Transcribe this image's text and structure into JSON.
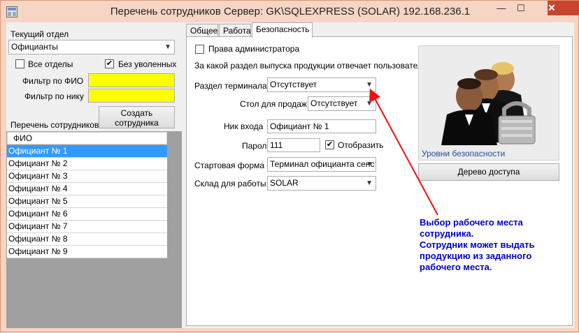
{
  "window": {
    "title": "Перечень сотрудников  Сервер: GK\\SQLEXPRESS (SOLAR) 192.168.236.1",
    "minimize": "—",
    "maximize": "☐",
    "close": "✕"
  },
  "left": {
    "current_dept_label": "Текущий отдел",
    "current_dept_value": "Официанты",
    "all_depts_label": "Все отделы",
    "all_depts_checked": false,
    "no_fired_label": "Без уволенных",
    "no_fired_checked": true,
    "filter_fio_label": "Фильтр по ФИО",
    "filter_fio_value": "",
    "filter_nick_label": "Фильтр по нику",
    "filter_nick_value": "",
    "create_button_line1": "Создать",
    "create_button_line2": "сотрудника",
    "list_label": "Перечень сотрудников",
    "grid_header": "ФИО",
    "rows": [
      "Официант № 1",
      "Официант № 2",
      "Официант № 3",
      "Официант № 4",
      "Официант № 5",
      "Официант № 6",
      "Официант № 7",
      "Официант № 8",
      "Официант № 9"
    ],
    "selected_index": 0
  },
  "tabs": [
    "Общее",
    "Работа",
    "Безопасность"
  ],
  "active_tab": "Безопасность",
  "security": {
    "admin_label": "Права администратора",
    "admin_checked": false,
    "question": "За какой раздел выпуска продукции отвечает пользователь",
    "terminal_label": "Раздел терминала",
    "terminal_value": "Отсутствует",
    "table_label": "Стол для продаж",
    "table_value": "Отсутствует",
    "login_label": "Ник входа",
    "login_value": "Официант № 1",
    "password_label": "Пароль",
    "password_value": "111",
    "show_label": "Отобразить",
    "show_checked": true,
    "start_form_label": "Стартовая форма",
    "start_form_value": "Терминал официанта сенс",
    "warehouse_label": "Склад для работы",
    "warehouse_value": "SOLAR",
    "security_levels_link": "Уровни безопасности",
    "access_tree_button": "Дерево доступа"
  },
  "annotation": {
    "lines": [
      "Выбор рабочего места",
      "сотрудника.",
      "Сотрудник может выдать",
      "продукцию из заданного",
      "рабочего места."
    ],
    "color": "#0000cc",
    "arrow_color": "#ee1111"
  },
  "colors": {
    "selection": "#3399ff",
    "filter_bg": "#ffff00",
    "frame": "#f6d5c4",
    "close": "#c7452f"
  }
}
